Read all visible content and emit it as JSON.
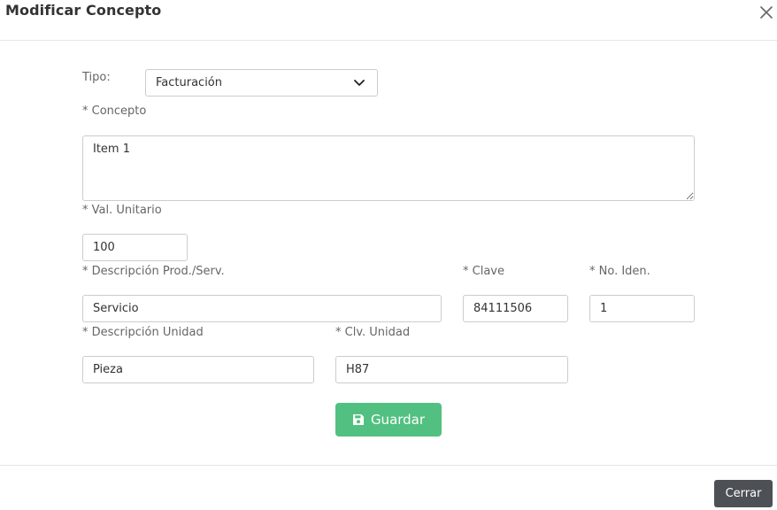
{
  "modal": {
    "title": "Modificar Concepto",
    "close_icon": "close-icon"
  },
  "form": {
    "tipo": {
      "label": "Tipo:",
      "selected": "Facturación"
    },
    "concepto": {
      "label": "* Concepto",
      "value": "Item 1"
    },
    "val_unitario": {
      "label": "* Val. Unitario",
      "value": "100"
    },
    "descripcion_prod_serv": {
      "label": "* Descripción Prod./Serv.",
      "value": "Servicio"
    },
    "clave": {
      "label": "* Clave",
      "value": "84111506"
    },
    "no_iden": {
      "label": "* No. Iden.",
      "value": "1"
    },
    "descripcion_unidad": {
      "label": "* Descripción Unidad",
      "value": "Pieza"
    },
    "clv_unidad": {
      "label": "* Clv. Unidad",
      "value": "H87"
    }
  },
  "buttons": {
    "guardar": "Guardar",
    "cerrar": "Cerrar"
  },
  "colors": {
    "save_button": "#52c080",
    "close_button": "#4d5156"
  }
}
